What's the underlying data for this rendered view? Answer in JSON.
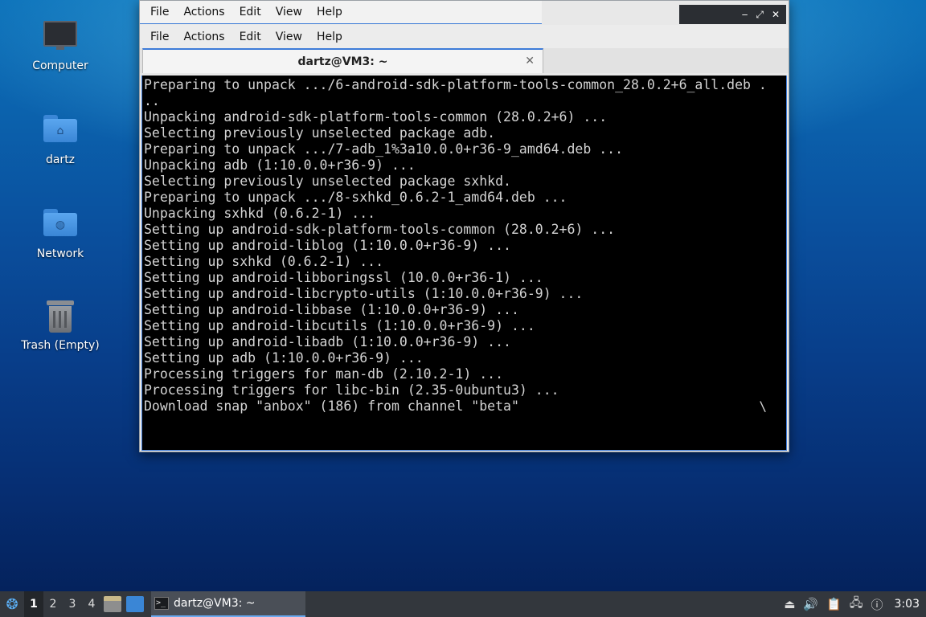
{
  "desktop": {
    "icons": [
      {
        "label": "Computer",
        "icon": "computer-icon"
      },
      {
        "label": "dartz",
        "icon": "home-folder-icon"
      },
      {
        "label": "Network",
        "icon": "network-folder-icon"
      },
      {
        "label": "Trash (Empty)",
        "icon": "trash-icon"
      }
    ]
  },
  "window": {
    "menubar_outer": [
      "File",
      "Actions",
      "Edit",
      "View",
      "Help"
    ],
    "menubar_inner": [
      "File",
      "Actions",
      "Edit",
      "View",
      "Help"
    ],
    "controls": {
      "minimize": "‒",
      "restore": "⤢",
      "close": "✕"
    },
    "tab": {
      "title": "dartz@VM3: ~",
      "close": "✕"
    }
  },
  "terminal": {
    "lines": [
      "Preparing to unpack .../6-android-sdk-platform-tools-common_28.0.2+6_all.deb .",
      "..",
      "Unpacking android-sdk-platform-tools-common (28.0.2+6) ...",
      "Selecting previously unselected package adb.",
      "Preparing to unpack .../7-adb_1%3a10.0.0+r36-9_amd64.deb ...",
      "Unpacking adb (1:10.0.0+r36-9) ...",
      "Selecting previously unselected package sxhkd.",
      "Preparing to unpack .../8-sxhkd_0.6.2-1_amd64.deb ...",
      "Unpacking sxhkd (0.6.2-1) ...",
      "Setting up android-sdk-platform-tools-common (28.0.2+6) ...",
      "Setting up android-liblog (1:10.0.0+r36-9) ...",
      "Setting up sxhkd (0.6.2-1) ...",
      "Setting up android-libboringssl (10.0.0+r36-1) ...",
      "Setting up android-libcrypto-utils (1:10.0.0+r36-9) ...",
      "Setting up android-libbase (1:10.0.0+r36-9) ...",
      "Setting up android-libcutils (1:10.0.0+r36-9) ...",
      "Setting up android-libadb (1:10.0.0+r36-9) ...",
      "Setting up adb (1:10.0.0+r36-9) ...",
      "Processing triggers for man-db (2.10.2-1) ...",
      "Processing triggers for libc-bin (2.35-0ubuntu3) ...",
      "Download snap \"anbox\" (186) from channel \"beta\""
    ],
    "spinner": "\\"
  },
  "taskbar": {
    "workspaces": [
      "1",
      "2",
      "3",
      "4"
    ],
    "active_workspace": "1",
    "task_title": "dartz@VM3: ~",
    "task_icon_text": ">_",
    "clock": "3:03"
  }
}
